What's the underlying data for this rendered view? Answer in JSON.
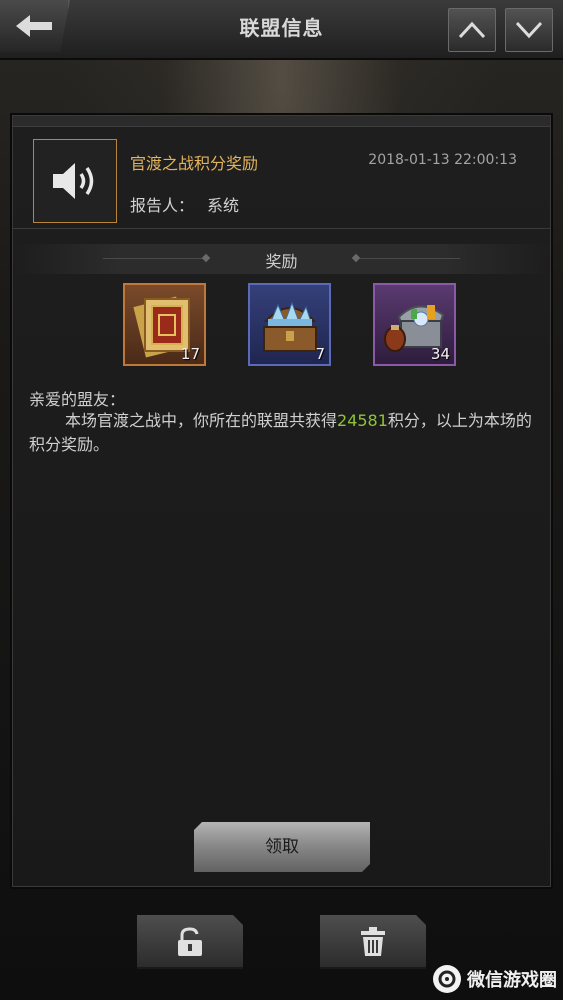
{
  "header": {
    "title": "联盟信息"
  },
  "mail": {
    "subject": "官渡之战积分奖励",
    "timestamp": "2018-01-13 22:00:13",
    "reporter_label": "报告人：",
    "reporter": "系统",
    "icon": "speaker-icon"
  },
  "rewards": {
    "label": "奖励",
    "items": [
      {
        "icon": "book-item-icon",
        "count": "17",
        "rarity_color": "#c0783a"
      },
      {
        "icon": "chest-item-icon",
        "count": "7",
        "rarity_color": "#5a6ab8"
      },
      {
        "icon": "treasure-chest-icon",
        "count": "34",
        "rarity_color": "#8a5aa8"
      }
    ]
  },
  "message": {
    "greeting": "亲爱的盟友：",
    "line_before": "本场官渡之战中，你所在的联盟共获得",
    "score": "24581",
    "line_after": "积分，以上为本场的积分奖励。"
  },
  "actions": {
    "claim_label": "领取",
    "lock_icon": "unlock-icon",
    "delete_icon": "trash-icon"
  },
  "watermark": {
    "text": "微信游戏圈"
  },
  "colors": {
    "accent_gold": "#e2b35e",
    "score_green": "#8fc43a"
  }
}
